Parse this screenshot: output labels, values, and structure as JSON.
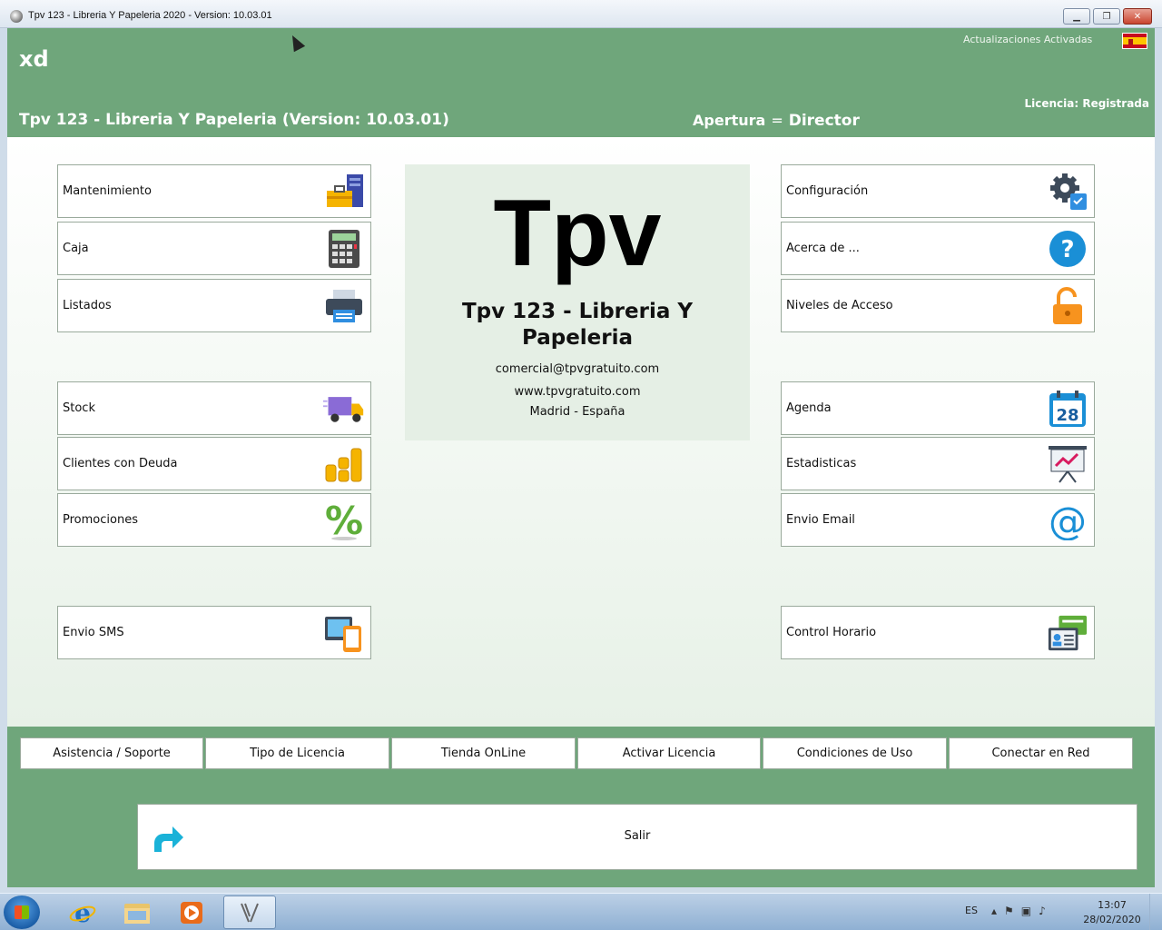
{
  "window": {
    "title": "Tpv 123 - Libreria Y Papeleria  2020 -  Version: 10.03.01",
    "minimize_label": "▭",
    "restore_label": "▣",
    "close_label": "✕"
  },
  "header": {
    "user": "xd",
    "updates": "Actualizaciones Activadas",
    "license": "Licencia: Registrada",
    "app_title": "Tpv 123 - Libreria Y Papeleria (Version: 10.03.01)",
    "opening_label": "Apertura",
    "opening_eq": "=",
    "opening_role": "Director",
    "flag_icon": "spain-flag-icon"
  },
  "left_tiles": [
    {
      "label": "Mantenimiento",
      "icon": "toolbox-icon"
    },
    {
      "label": "Caja",
      "icon": "calculator-icon"
    },
    {
      "label": "Listados",
      "icon": "printer-icon"
    },
    {
      "label": "Stock",
      "icon": "delivery-truck-icon"
    },
    {
      "label": "Clientes con Deuda",
      "icon": "coins-icon"
    },
    {
      "label": "Promociones",
      "icon": "percent-icon"
    },
    {
      "label": "Envio SMS",
      "icon": "devices-icon"
    }
  ],
  "right_tiles": [
    {
      "label": "Configuración",
      "icon": "gear-icon"
    },
    {
      "label": "Acerca de ...",
      "icon": "help-icon"
    },
    {
      "label": "Niveles de Acceso",
      "icon": "padlock-icon"
    },
    {
      "label": "Agenda",
      "icon": "calendar-icon",
      "day": "28"
    },
    {
      "label": "Estadisticas",
      "icon": "stats-board-icon"
    },
    {
      "label": "Envio Email",
      "icon": "at-sign-icon"
    },
    {
      "label": "Control Horario",
      "icon": "id-cards-icon"
    }
  ],
  "center": {
    "logo": "Tpv",
    "title": "Tpv 123 - Libreria Y Papeleria",
    "email": "comercial@tpvgratuito.com",
    "web": "www.tpvgratuito.com",
    "location": "Madrid - España"
  },
  "bottom_buttons": [
    "Asistencia / Soporte",
    "Tipo de Licencia",
    "Tienda OnLine",
    "Activar Licencia",
    "Condiciones de Uso",
    "Conectar en Red"
  ],
  "exit": {
    "label": "Salir",
    "icon": "exit-arrow-icon"
  },
  "taskbar": {
    "language": "ES",
    "time": "13:07",
    "date": "28/02/2020",
    "items": [
      "internet-explorer-icon",
      "file-explorer-icon",
      "media-player-icon",
      "tpv-app-icon"
    ]
  },
  "colors": {
    "header_green": "#6fa67b",
    "accent_blue": "#1a8fd6",
    "accent_orange": "#f7931e"
  }
}
